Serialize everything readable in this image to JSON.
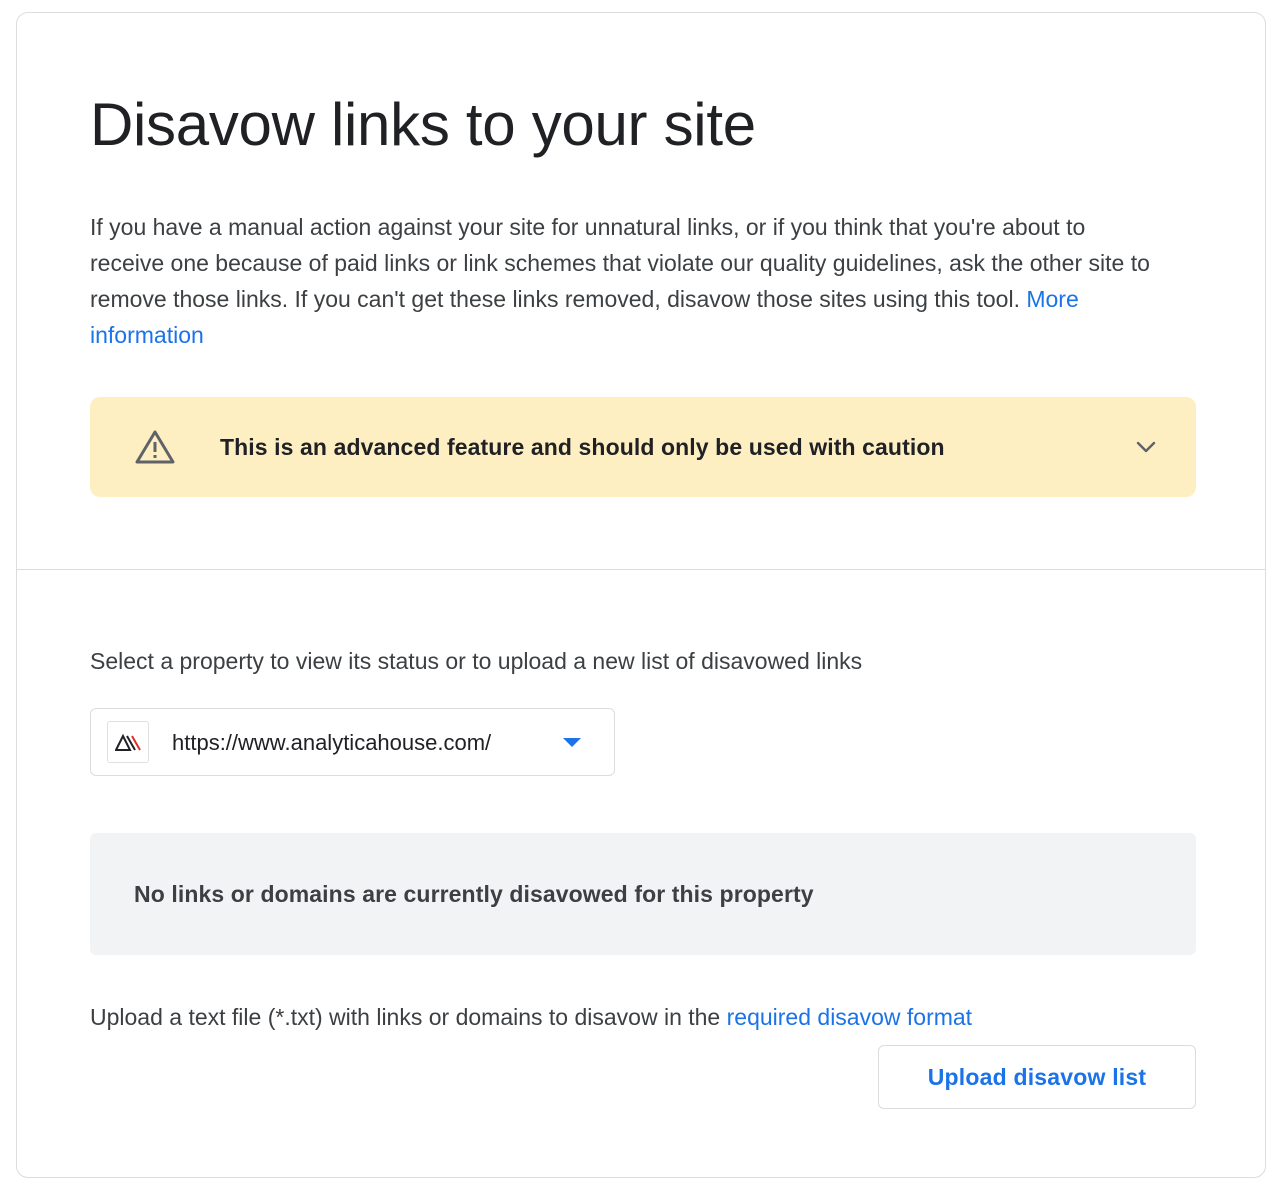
{
  "page": {
    "title": "Disavow links to your site",
    "intro_text": "If you have a manual action against your site for unnatural links, or if you think that you're about to receive one because of paid links or link schemes that violate our quality guidelines, ask the other site to remove those links. If you can't get these links removed, disavow those sites using this tool.",
    "intro_link": "More information"
  },
  "warning": {
    "text": "This is an advanced feature and should only be used with caution",
    "icon": "warning-triangle-icon",
    "expand_icon": "chevron-down-icon"
  },
  "property": {
    "label": "Select a property to view its status or to upload a new list of disavowed links",
    "selected_url": "https://www.analyticahouse.com/",
    "favicon": "analyticahouse-logo-icon"
  },
  "status": {
    "message": "No links or domains are currently disavowed for this property"
  },
  "upload": {
    "instruction": "Upload a text file (*.txt) with links or domains to disavow in the",
    "format_link": "required disavow format",
    "button_label": "Upload disavow list"
  },
  "colors": {
    "accent": "#1a73e8",
    "warning_bg": "#feefc3",
    "status_bg": "#f1f3f4",
    "border": "#dadce0",
    "text": "#202124"
  }
}
